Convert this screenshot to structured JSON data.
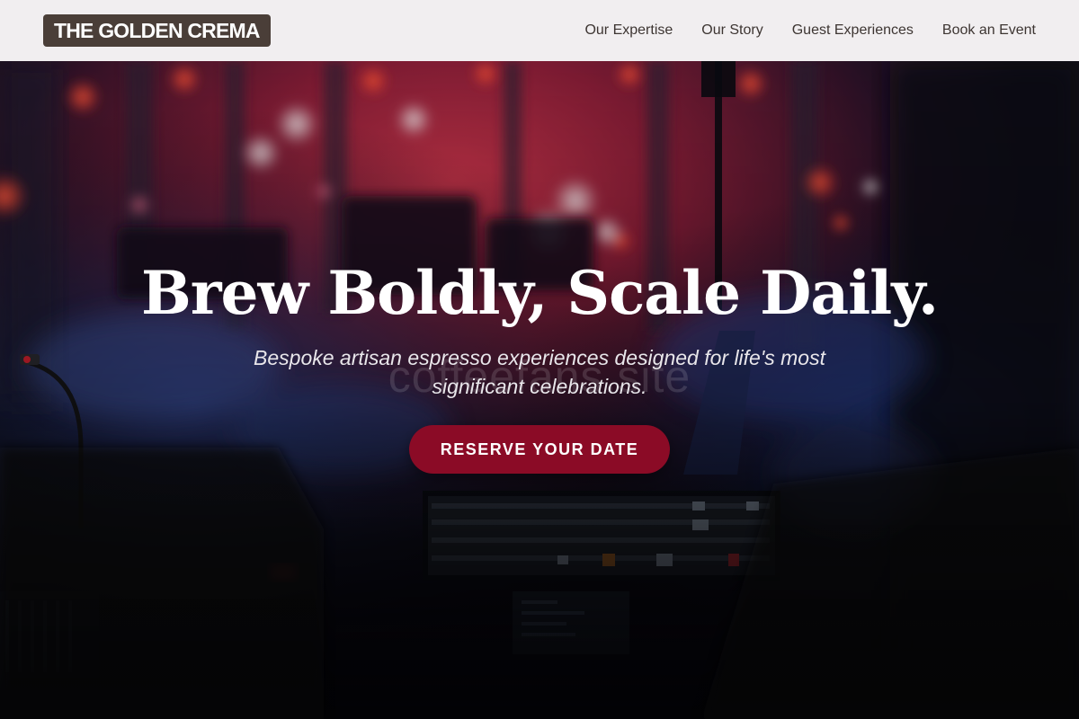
{
  "brand": {
    "name": "THE GOLDEN CREMA"
  },
  "nav": {
    "links": [
      "Our Expertise",
      "Our Story",
      "Guest Experiences",
      "Book an Event"
    ]
  },
  "hero": {
    "headline": "Brew Boldly, Scale Daily.",
    "subtitle": "Bespoke artisan espresso experiences designed for life's most significant celebrations.",
    "watermark": "coffeefans.site",
    "cta_label": "RESERVE YOUR DATE"
  },
  "colors": {
    "brand_badge": "#4a3e38",
    "cta": "#8b0b26",
    "navbar": "#f1eef0"
  }
}
